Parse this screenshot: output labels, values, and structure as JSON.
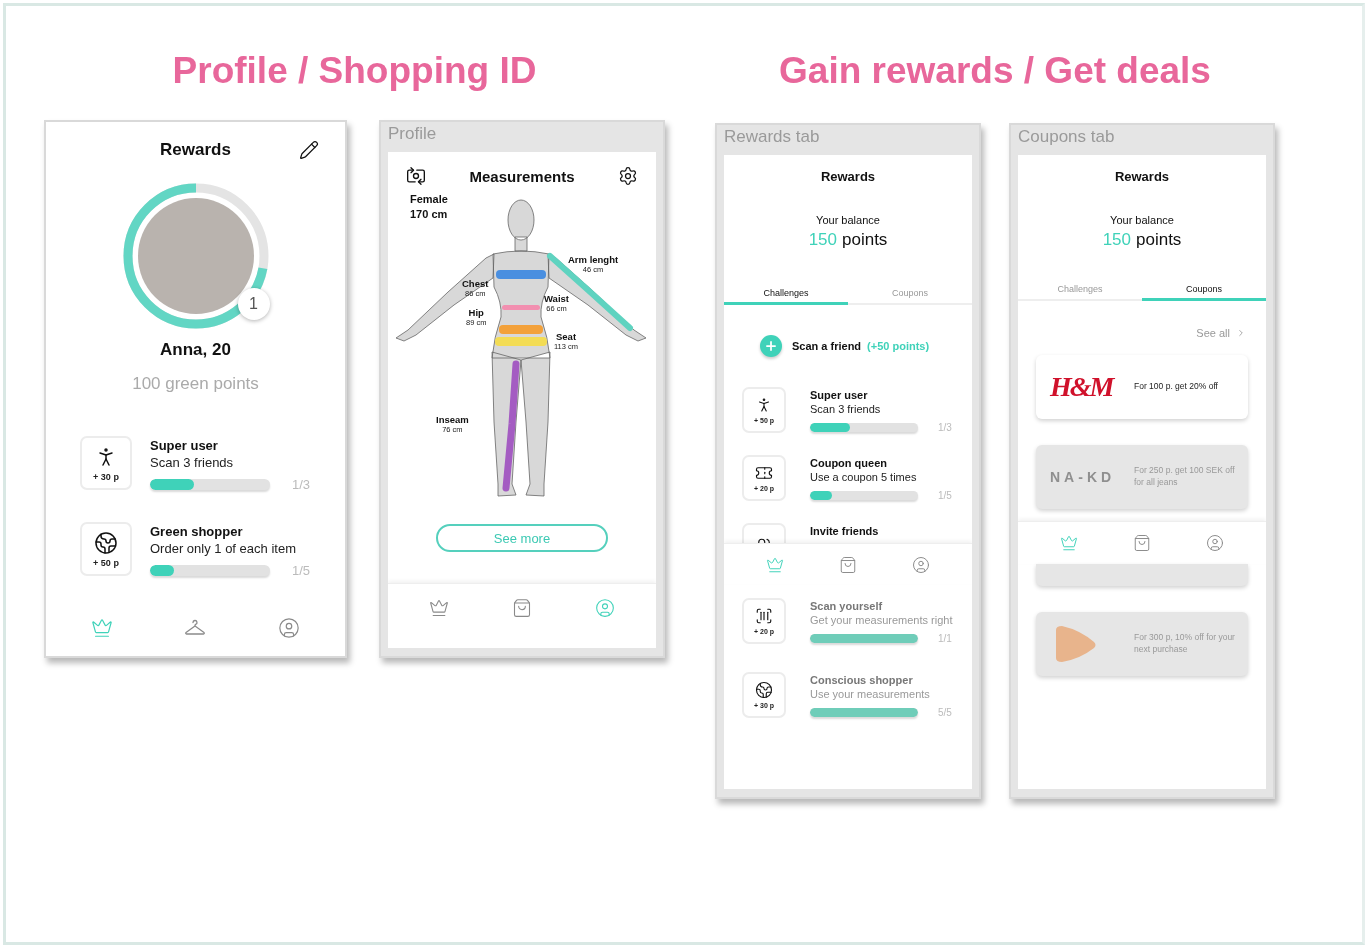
{
  "sections": [
    {
      "heading": "Profile / Shopping ID",
      "phones": [
        {
          "kind": "profile",
          "title": "Rewards",
          "avatar": {
            "level": 0.72,
            "badge": "1"
          },
          "name": "Anna, 20",
          "points": "100 green points",
          "challenges": [
            {
              "kind": "person",
              "points": "+ 30 p",
              "title": "Super user",
              "subtitle": "Scan 3 friends",
              "level": 0.37,
              "count": "1/3",
              "completed": false
            },
            {
              "kind": "globe",
              "points": "+ 50 p",
              "title": "Green shopper",
              "subtitle": "Order only 1 of each item",
              "level": 0.2,
              "count": "1/5",
              "completed": false
            }
          ],
          "nav": [
            {
              "kind": "crown",
              "selected": true
            },
            {
              "kind": "hanger",
              "selected": false
            },
            {
              "kind": "user",
              "selected": false
            }
          ]
        },
        {
          "kind": "measurements",
          "label": "Profile",
          "title": "Measurements",
          "gender": "Female",
          "height": "170 cm",
          "measurements": [
            {
              "label": "Arm lenght",
              "value": "46 cm",
              "color": "#5fd3c0"
            },
            {
              "label": "Chest",
              "value": "86 cm",
              "color": "#4a8fe0"
            },
            {
              "label": "Waist",
              "value": "66 cm",
              "color": "#f28fb0"
            },
            {
              "label": "Hip",
              "value": "89 cm",
              "color": "#f3a13a"
            },
            {
              "label": "Seat",
              "value": "113 cm",
              "color": "#f3dc55"
            },
            {
              "label": "Inseam",
              "value": "76 cm",
              "color": "#a45cc2"
            }
          ],
          "button": "See more",
          "nav": [
            {
              "kind": "crown",
              "selected": false
            },
            {
              "kind": "bag",
              "selected": false
            },
            {
              "kind": "user",
              "selected": true
            }
          ]
        }
      ]
    },
    {
      "heading": "Gain rewards / Get deals",
      "phones": [
        {
          "kind": "challenges",
          "label": "Rewards tab",
          "title": "Rewards",
          "balance_label": "Your balance",
          "balance_value": "150",
          "balance_unit": "points",
          "tabs": [
            {
              "label": "Challenges",
              "selected": true
            },
            {
              "label": "Coupons",
              "selected": false
            }
          ],
          "scan": {
            "label": "Scan a friend",
            "bonus": "(+50 points)"
          },
          "challenges": [
            {
              "kind": "person",
              "points": "+ 50 p",
              "title": "Super user",
              "subtitle": "Scan 3 friends",
              "level": 0.37,
              "count": "1/3",
              "completed": false
            },
            {
              "kind": "ticket",
              "points": "+ 20 p",
              "title": "Coupon queen",
              "subtitle": "Use a coupon 5 times",
              "level": 0.2,
              "count": "1/5",
              "completed": false
            },
            {
              "kind": "friends",
              "title": "Invite friends",
              "completed": false
            }
          ],
          "nav": [
            {
              "kind": "crown",
              "selected": true
            },
            {
              "kind": "bag",
              "selected": false
            },
            {
              "kind": "user",
              "selected": false
            }
          ],
          "challenges_below": [
            {
              "kind": "barcode",
              "points": "+ 20 p",
              "title": "Scan yourself",
              "subtitle": "Get your measurements right",
              "level": 1,
              "count": "1/1",
              "completed": true
            },
            {
              "kind": "globe",
              "points": "+ 30 p",
              "title": "Conscious shopper",
              "subtitle": "Use your measurements",
              "level": 1,
              "count": "5/5",
              "completed": true
            }
          ]
        },
        {
          "kind": "coupons",
          "label": "Coupons tab",
          "title": "Rewards",
          "balance_label": "Your balance",
          "balance_value": "150",
          "balance_unit": "points",
          "tabs": [
            {
              "label": "Challenges",
              "selected": false
            },
            {
              "label": "Coupons",
              "selected": true
            }
          ],
          "see_all": "See all",
          "coupons": [
            {
              "kind": "full",
              "logo": {
                "kind": "script",
                "text": "H&M",
                "color": "#d0112b"
              },
              "text": "For 100 p. get 20% off",
              "available": true
            },
            {
              "kind": "full",
              "logo": {
                "kind": "spaced",
                "text": "NA-KD",
                "color": "#8f8f8f"
              },
              "text": "For 250 p. get 100 SEK off for all jeans",
              "available": false
            }
          ],
          "nav": [
            {
              "kind": "crown",
              "selected": true
            },
            {
              "kind": "bag",
              "selected": false
            },
            {
              "kind": "user",
              "selected": false
            }
          ],
          "coupons_below": [
            {
              "kind": "partial",
              "available": false
            },
            {
              "kind": "full",
              "logo": {
                "kind": "shape",
                "color": "#e8b48c"
              },
              "text": "For 300 p, 10% off for your next purchase",
              "available": false
            }
          ]
        }
      ]
    }
  ]
}
